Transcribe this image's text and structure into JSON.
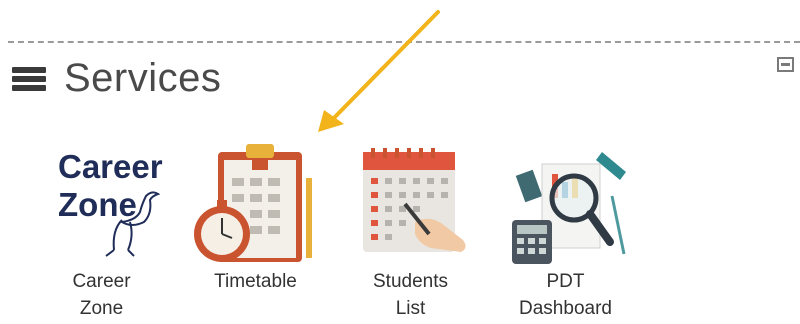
{
  "panel": {
    "title": "Services"
  },
  "services": [
    {
      "label_line1": "Career",
      "label_line2": "Zone",
      "logo_text_line1": "Career",
      "logo_text_line2": "Zone"
    },
    {
      "label_line1": "Timetable",
      "label_line2": ""
    },
    {
      "label_line1": "Students",
      "label_line2": "List"
    },
    {
      "label_line1": "PDT",
      "label_line2": "Dashboard"
    }
  ],
  "icons": {
    "menu": "hamburger-icon",
    "collapse": "collapse-icon",
    "annotation": "arrow-icon"
  },
  "colors": {
    "arrow": "#f2b31b",
    "career_navy": "#1f2d58"
  }
}
